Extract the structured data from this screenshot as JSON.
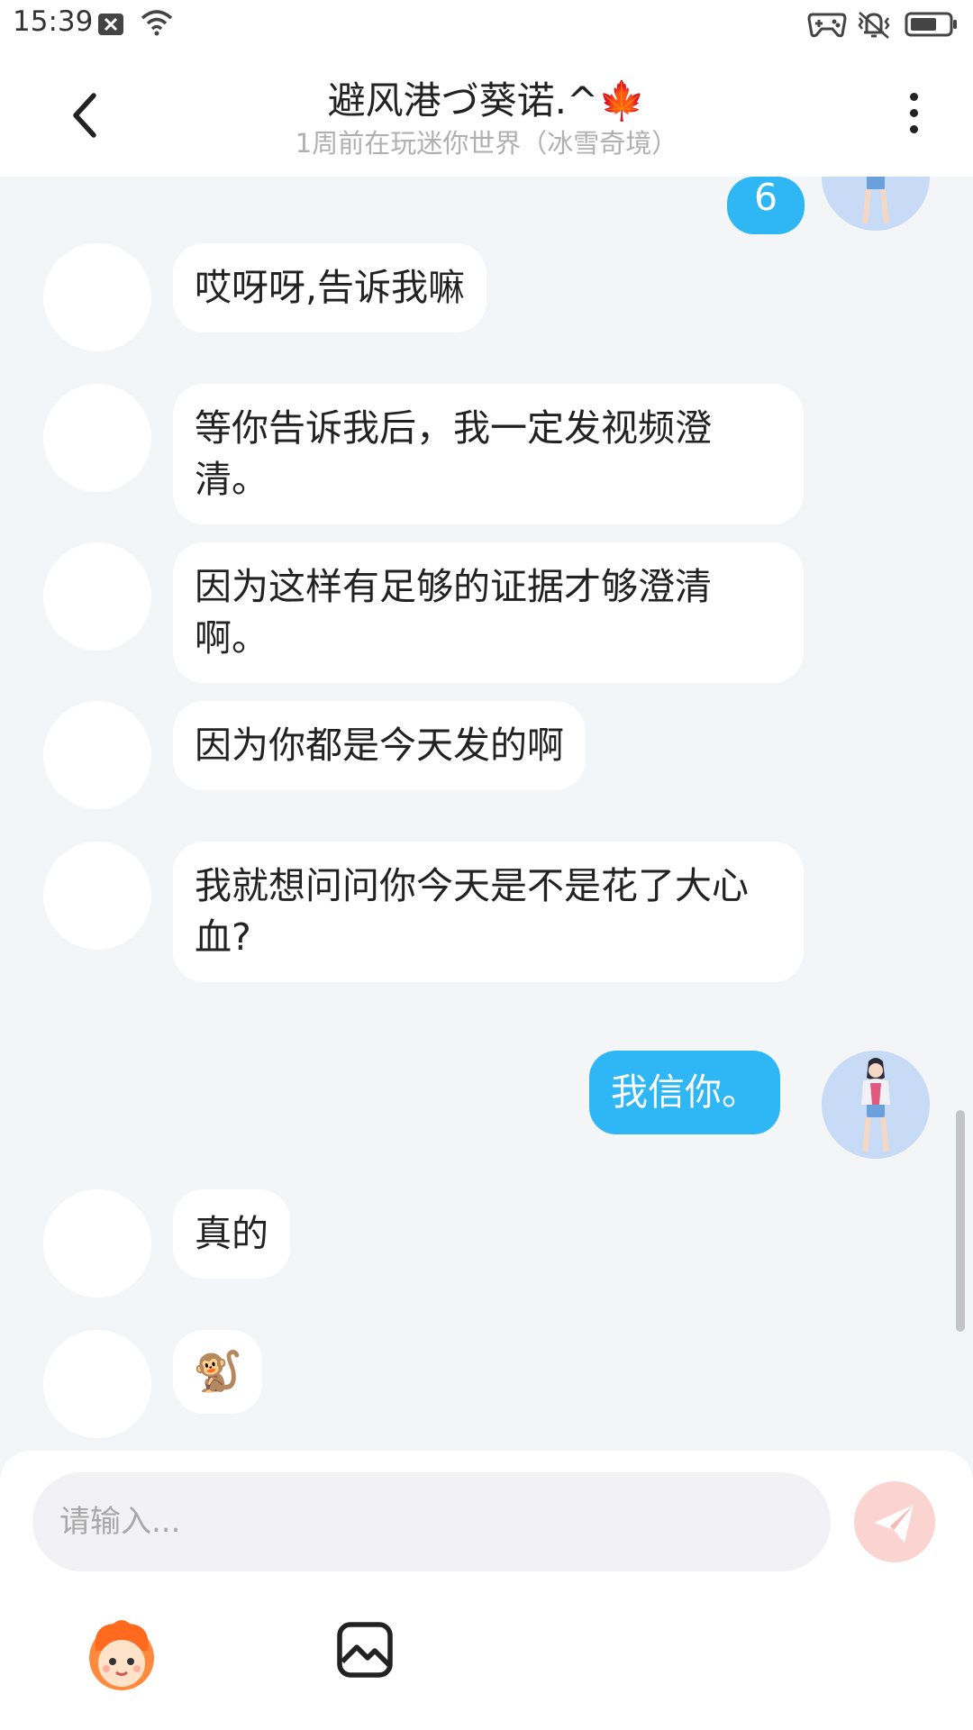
{
  "status_bar": {
    "time": "15:39",
    "icons": [
      "notification-x-icon",
      "wifi-icon",
      "gamepad-icon",
      "vibrate-icon",
      "battery-icon"
    ]
  },
  "header": {
    "title": "避风港づ葵诺.^🍁",
    "subtitle": "1周前在玩迷你世界（冰雪奇境）",
    "back_icon": "chevron-left-icon",
    "more_icon": "more-vertical-icon"
  },
  "messages": [
    {
      "side": "right",
      "text": "6"
    },
    {
      "side": "left",
      "text": "哎呀呀,告诉我嘛"
    },
    {
      "side": "left",
      "text": "等你告诉我后，我一定发视频澄清。"
    },
    {
      "side": "left",
      "text": "因为这样有足够的证据才够澄清啊。"
    },
    {
      "side": "left",
      "text": "因为你都是今天发的啊"
    },
    {
      "side": "left",
      "text": "我就想问问你今天是不是花了大心血?"
    },
    {
      "side": "right",
      "text": "我信你。"
    },
    {
      "side": "left",
      "text": "真的"
    },
    {
      "side": "left",
      "text": "🐒"
    }
  ],
  "input": {
    "placeholder": "请输入...",
    "send_icon": "paper-plane-icon",
    "emoji_icon": "mascot-face-icon",
    "image_icon": "image-icon"
  },
  "colors": {
    "bubble_self": "#2eb6f5",
    "bubble_other": "#ffffff",
    "background": "#f4f5f7",
    "send_button": "#fbd4d2"
  }
}
